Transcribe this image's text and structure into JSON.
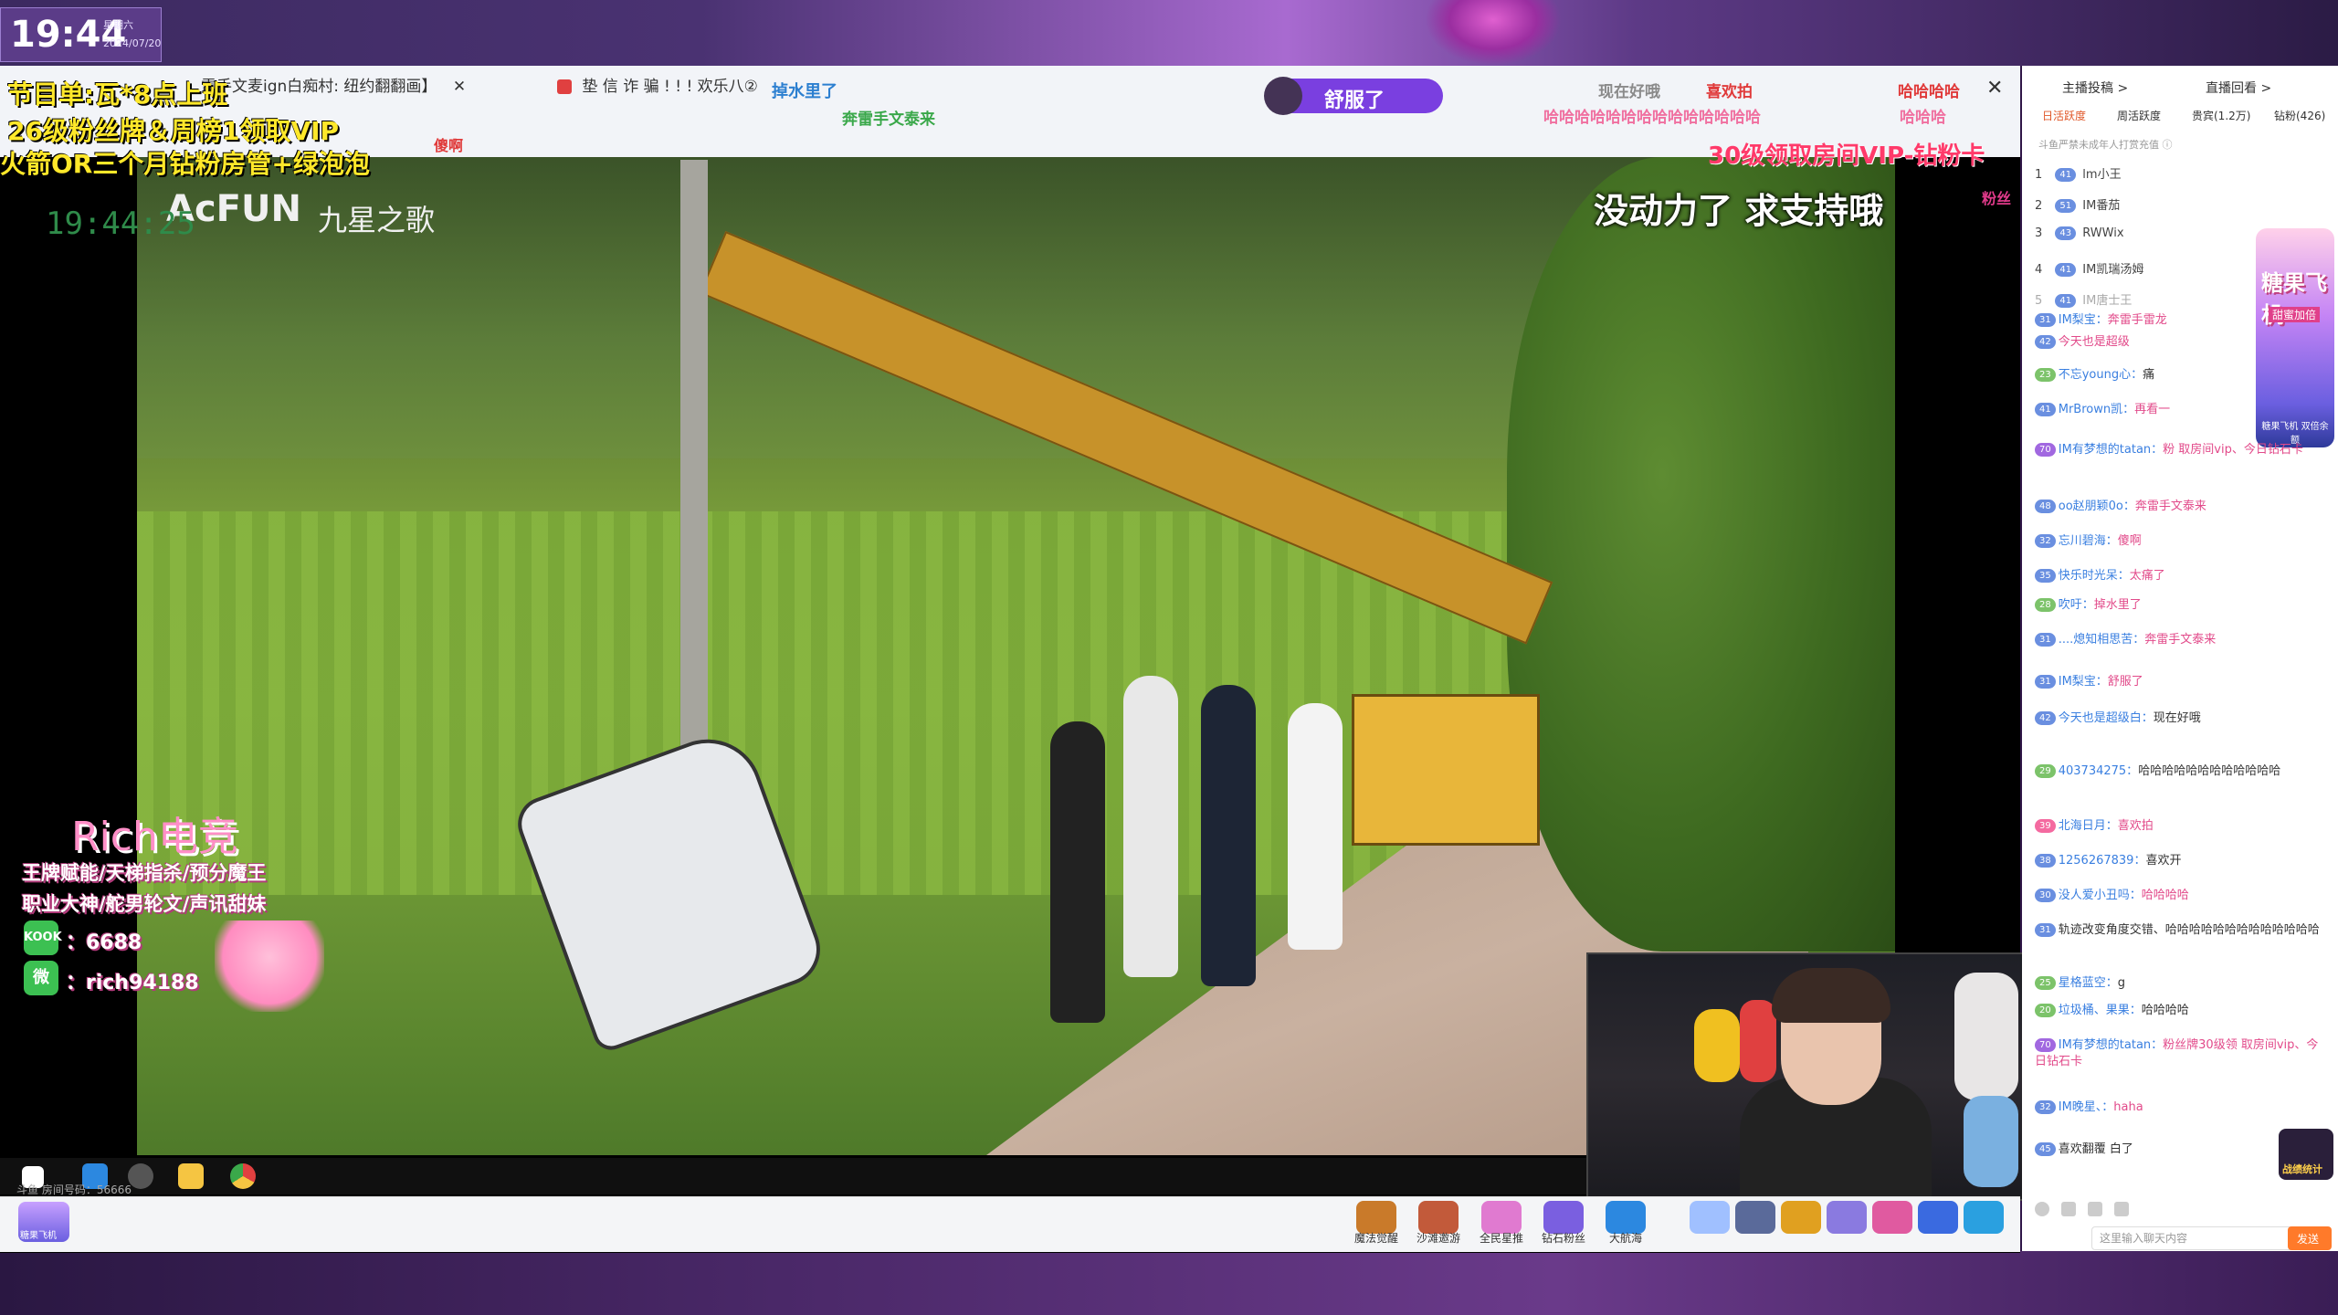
{
  "clock": {
    "time": "19:44",
    "weekday": "星期六",
    "date": "2024/07/20"
  },
  "digital_time": "19:44:25",
  "browser_tabs": [
    {
      "label": "雷手文麦ign白痴村: 纽约翻翻画】",
      "close": "✕"
    },
    {
      "label": "垫 信 诈 骗 ! ! ! 欢乐八②",
      "close": ""
    }
  ],
  "danmu": {
    "d1": "掉水里了",
    "d2": "奔雷手文泰来",
    "d3": "傻啊",
    "d4": "现在好哦",
    "d5": "喜欢拍",
    "d6": "哈哈哈哈",
    "d7": "哈哈哈哈哈哈哈哈哈哈哈哈哈哈",
    "d8": "30级领取房间VIP-钻粉卡",
    "d9": "哈哈哈",
    "d10": "粉丝",
    "shufu": "舒服了"
  },
  "overlay": {
    "line1": "节目单:瓦*8点上班",
    "line2": "26级粉丝牌＆周榜1领取VIP",
    "line3": "火箭OR三个月钻粉房管+绿泡泡"
  },
  "video": {
    "watermark": "AcFUN",
    "watermark_sub": "九星之歌",
    "caption": "没动力了 求支持哦"
  },
  "rich": {
    "title": "Rich电竞",
    "line1": "王牌赋能/天梯指杀/预分魔王",
    "line2": "职业大神/舵男轮文/声讯甜妹",
    "kook_label": "KOOK",
    "kook": "：6688",
    "wechat_label": "微",
    "wechat": "：rich94188"
  },
  "taskbar": {
    "room_text": "斗鱼 房间号码：56666"
  },
  "player": {
    "candy_label": "糖果飞机",
    "gifts": [
      "魔法觉醒",
      "沙滩邀游",
      "全民星推",
      "钻石粉丝",
      "大航海"
    ]
  },
  "panel": {
    "top_tabs": [
      "主播投稿 >",
      "直播回看 >"
    ],
    "tabs": [
      "日活跃度",
      "周活跃度",
      "贵宾(1.2万)",
      "钻粉(426)"
    ],
    "notice": "斗鱼严禁未成年人打赏充值 ⓘ",
    "ranks": [
      {
        "n": "1",
        "lvl": "41",
        "name": "lm小王"
      },
      {
        "n": "2",
        "lvl": "51",
        "name": "IM番茄"
      },
      {
        "n": "3",
        "lvl": "43",
        "name": "RWWix"
      },
      {
        "n": "4",
        "lvl": "41",
        "name": "IM凯瑞汤姆"
      },
      {
        "n": "5",
        "lvl": "41",
        "name": "IM唐士王"
      }
    ],
    "chat": [
      {
        "lvl": "31",
        "user": "IM梨宝：",
        "msg": "奔雷手雷龙"
      },
      {
        "lvl": "42",
        "user": "",
        "msg": "今天也是超级"
      },
      {
        "lvl": "23",
        "user": "不忘young心：",
        "msg": "痛"
      },
      {
        "lvl": "41",
        "user": "MrBrown凯：",
        "msg": "再看一"
      },
      {
        "lvl": "70",
        "user": "IM有梦想的tatan：",
        "msg": "粉 取房间vip、今日钻石卡"
      },
      {
        "lvl": "48",
        "user": "oo赵朋颖0o：",
        "msg": "奔雷手文泰来"
      },
      {
        "lvl": "32",
        "user": "忘川碧海：",
        "msg": "傻啊"
      },
      {
        "lvl": "35",
        "user": "快乐时光呆：",
        "msg": "太痛了"
      },
      {
        "lvl": "28",
        "user": "吹吁：",
        "msg": "掉水里了"
      },
      {
        "lvl": "31",
        "user": "....熄知相思苦：",
        "msg": "奔雷手文泰来"
      },
      {
        "lvl": "31",
        "user": "IM梨宝：",
        "msg": "舒服了"
      },
      {
        "lvl": "42",
        "user": "今天也是超级白：",
        "msg": "现在好哦"
      },
      {
        "lvl": "29",
        "user": "403734275：",
        "msg": "哈哈哈哈哈哈哈哈哈哈哈哈"
      },
      {
        "lvl": "39",
        "user": "北海日月：",
        "msg": "喜欢拍"
      },
      {
        "lvl": "38",
        "user": "1256267839：",
        "msg": "喜欢开"
      },
      {
        "lvl": "30",
        "user": "没人爱小丑吗：",
        "msg": "哈哈哈哈"
      },
      {
        "lvl": "31",
        "user": "",
        "msg": "轨迹改变角度交错、哈哈哈哈哈哈哈哈哈哈哈哈哈"
      },
      {
        "lvl": "25",
        "user": "星格蓝空：",
        "msg": "g"
      },
      {
        "lvl": "20",
        "user": "垃圾桶、果果：",
        "msg": "哈哈哈哈"
      },
      {
        "lvl": "70",
        "user": "IM有梦想的tatan：",
        "msg": "粉丝牌30级领 取房间vip、今日钻石卡"
      },
      {
        "lvl": "32",
        "user": "IM晚星、：",
        "msg": "haha"
      },
      {
        "lvl": "45",
        "user": "",
        "msg": "喜欢翻覆 白了"
      }
    ],
    "candy": "糖果飞机",
    "candy2": "甜蜜加倍",
    "candy3": "糖果飞机 双倍余额",
    "input_placeholder": "这里输入聊天内容",
    "send_label": "发送",
    "rank_label": "战绩统计"
  }
}
